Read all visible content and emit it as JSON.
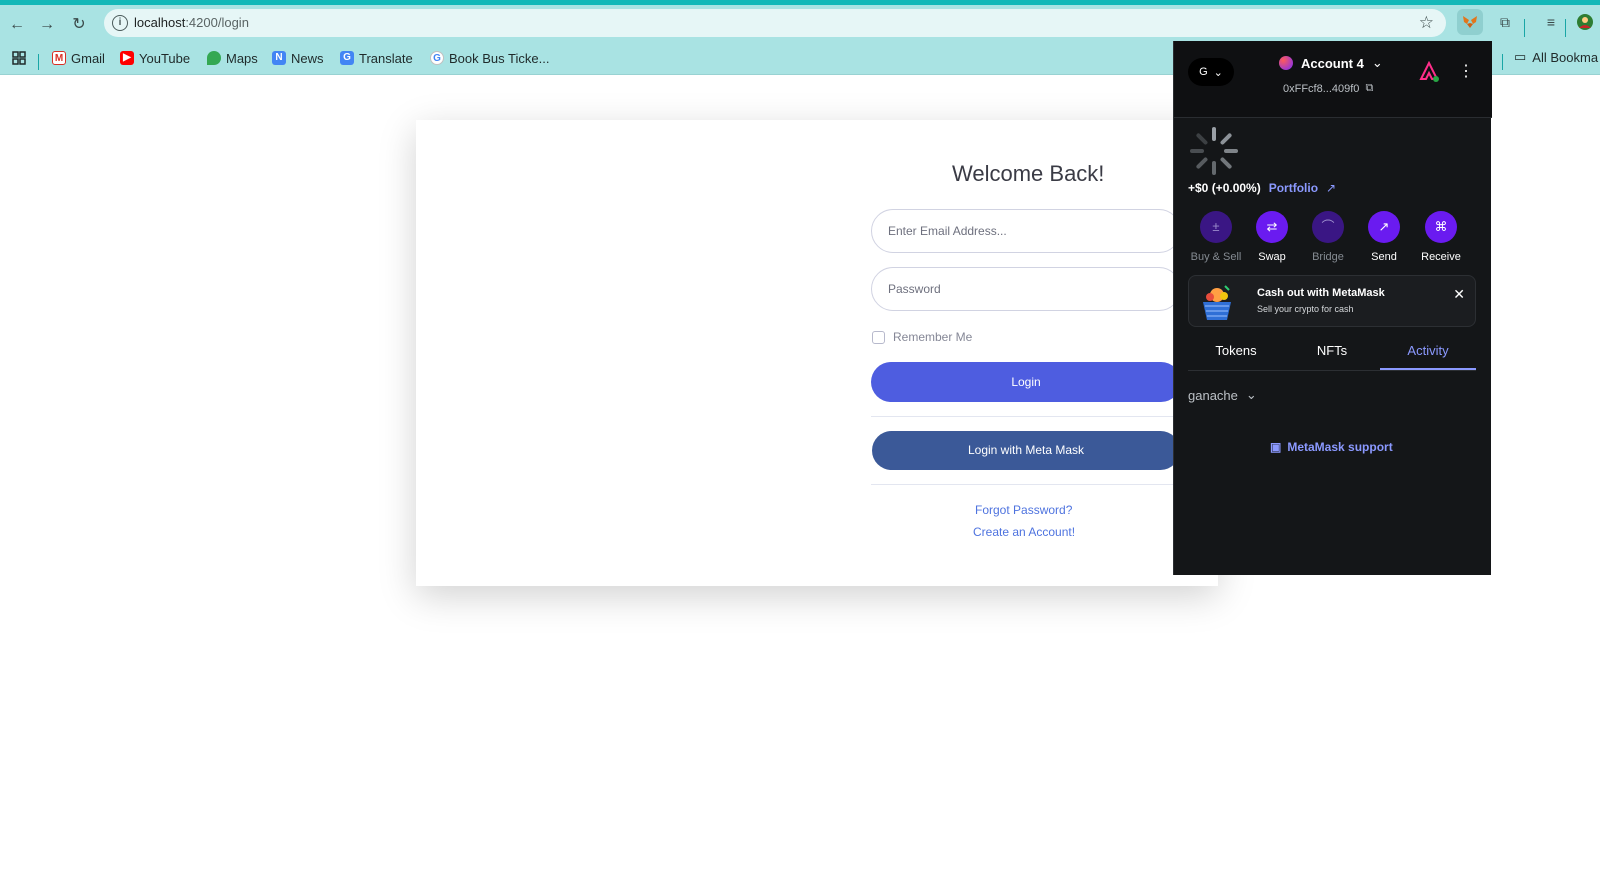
{
  "browser": {
    "url_host": "localhost",
    "url_path": ":4200/login",
    "bookmarks": [
      {
        "label": "Gmail",
        "icon": "gmail-icon",
        "color": "#d93025"
      },
      {
        "label": "YouTube",
        "icon": "youtube-icon",
        "color": "#ff0000"
      },
      {
        "label": "Maps",
        "icon": "maps-icon",
        "color": "#34a853"
      },
      {
        "label": "News",
        "icon": "news-icon",
        "color": "#4285f4"
      },
      {
        "label": "Translate",
        "icon": "translate-icon",
        "color": "#4285f4"
      },
      {
        "label": "Book Bus Ticke...",
        "icon": "google-icon",
        "color": "#4285f4"
      }
    ],
    "all_bookmarks": "All Bookma"
  },
  "login": {
    "title": "Welcome Back!",
    "email_placeholder": "Enter Email Address...",
    "password_placeholder": "Password",
    "remember_label": "Remember Me",
    "login_button": "Login",
    "metamask_button": "Login with Meta Mask",
    "forgot_link": "Forgot Password?",
    "create_link": "Create an Account!"
  },
  "metamask": {
    "network_initial": "G",
    "account_name": "Account 4",
    "address": "0xFFcf8...409f0",
    "change_value": "+$0 (+0.00%)",
    "portfolio_label": "Portfolio",
    "actions": [
      {
        "label": "Buy & Sell",
        "icon": "buy-sell-icon",
        "enabled": false
      },
      {
        "label": "Swap",
        "icon": "swap-icon",
        "enabled": true
      },
      {
        "label": "Bridge",
        "icon": "bridge-icon",
        "enabled": false
      },
      {
        "label": "Send",
        "icon": "send-icon",
        "enabled": true
      },
      {
        "label": "Receive",
        "icon": "receive-icon",
        "enabled": true
      }
    ],
    "banner_title": "Cash out with MetaMask",
    "banner_subtitle": "Sell your crypto for cash",
    "tabs": [
      {
        "label": "Tokens"
      },
      {
        "label": "NFTs"
      },
      {
        "label": "Activity",
        "active": true
      }
    ],
    "network_filter": "ganache",
    "support_label": "MetaMask support"
  }
}
